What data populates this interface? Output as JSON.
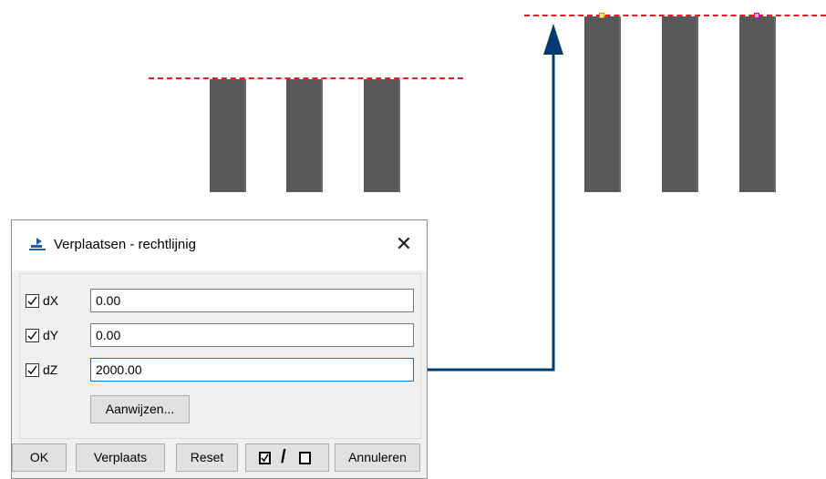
{
  "dialog": {
    "title": "Verplaatsen - rechtlijnig",
    "rows": [
      {
        "label": "dX",
        "checked": true,
        "value": "0.00"
      },
      {
        "label": "dY",
        "checked": true,
        "value": "0.00"
      },
      {
        "label": "dZ",
        "checked": true,
        "value": "2000.00"
      }
    ],
    "pick_button": "Aanwijzen...",
    "buttons": {
      "ok": "OK",
      "move": "Verplaats",
      "reset": "Reset",
      "toggle_separator": "/",
      "cancel": "Annuleren"
    }
  },
  "colors": {
    "column": "#59595c",
    "reference_line": "#e02020",
    "arrow": "#003a70",
    "focus_border": "#0078d7"
  }
}
